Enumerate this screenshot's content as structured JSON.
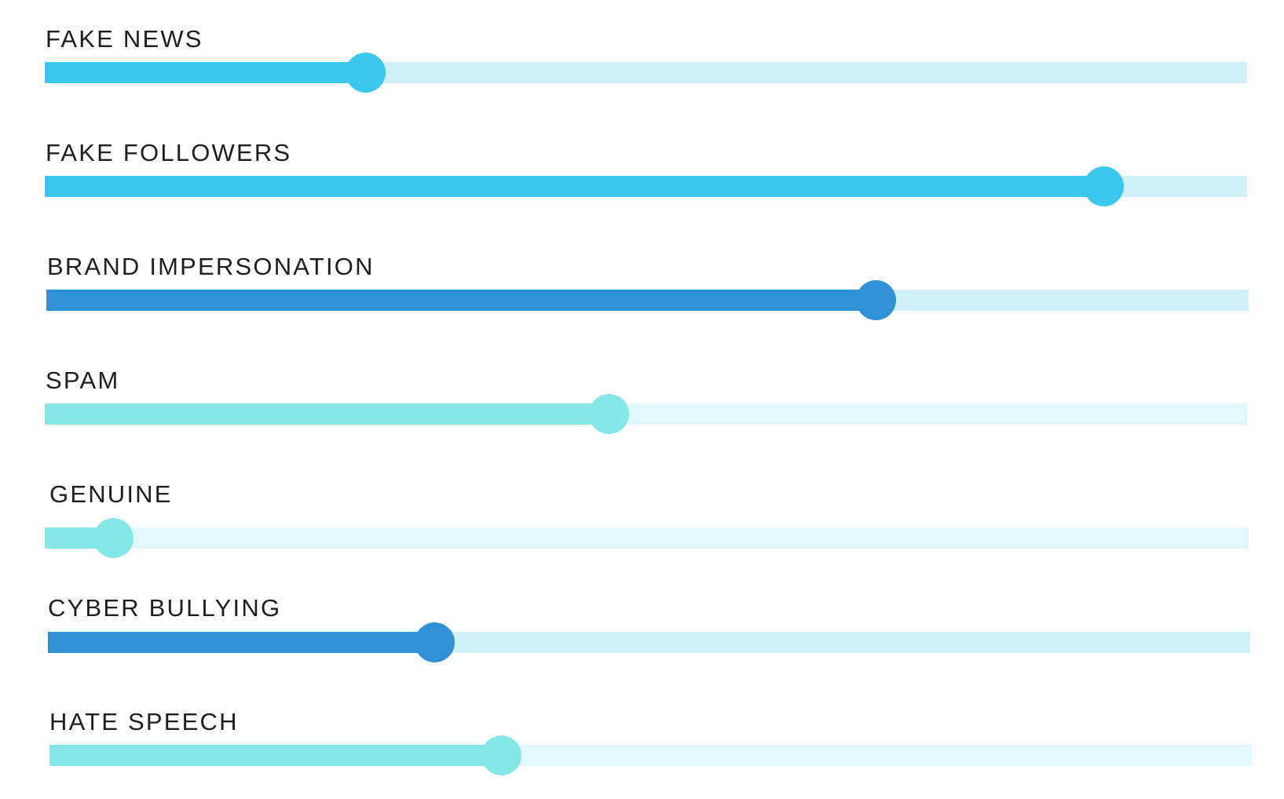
{
  "sliders": [
    {
      "label": "FAKE NEWS",
      "value": 0.267,
      "fill_color": "#3AC8EF",
      "track_color": "#D0F1FA"
    },
    {
      "label": "FAKE FOLLOWERS",
      "value": 0.881,
      "fill_color": "#3AC8EF",
      "track_color": "#D0F1FA"
    },
    {
      "label": "BRAND IMPERSONATION",
      "value": 0.69,
      "fill_color": "#2F91D6",
      "track_color": "#D0F1FA"
    },
    {
      "label": "SPAM",
      "value": 0.469,
      "fill_color": "#86E8E6",
      "track_color": "#E0F8F9"
    },
    {
      "label": "GENUINE",
      "value": 0.057,
      "fill_color": "#86E8E6",
      "track_color": "#E0F8F9"
    },
    {
      "label": "CYBER BULLYING",
      "value": 0.322,
      "fill_color": "#2F91D6",
      "track_color": "#D0F1FA"
    },
    {
      "label": "HATE SPEECH",
      "value": 0.376,
      "fill_color": "#86E8E6",
      "track_color": "#E0F8F9"
    }
  ]
}
